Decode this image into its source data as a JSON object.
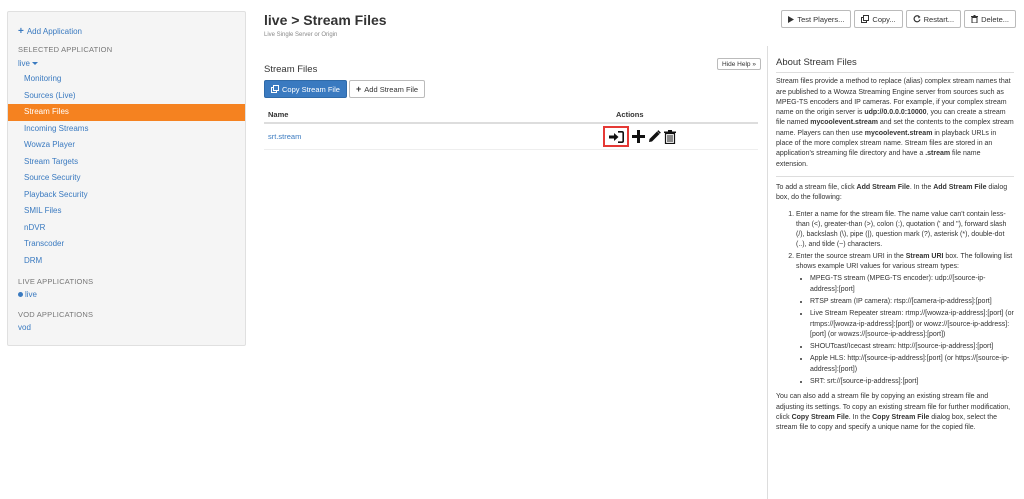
{
  "sidebar": {
    "add_application": "Add Application",
    "selected_heading": "SELECTED APPLICATION",
    "selected_app": "live",
    "nav": [
      {
        "label": "Monitoring",
        "active": false
      },
      {
        "label": "Sources (Live)",
        "active": false
      },
      {
        "label": "Stream Files",
        "active": true
      },
      {
        "label": "Incoming Streams",
        "active": false
      },
      {
        "label": "Wowza Player",
        "active": false
      },
      {
        "label": "Stream Targets",
        "active": false
      },
      {
        "label": "Source Security",
        "active": false
      },
      {
        "label": "Playback Security",
        "active": false
      },
      {
        "label": "SMIL Files",
        "active": false
      },
      {
        "label": "nDVR",
        "active": false
      },
      {
        "label": "Transcoder",
        "active": false
      },
      {
        "label": "DRM",
        "active": false
      }
    ],
    "live_heading": "LIVE APPLICATIONS",
    "live_app": "live",
    "vod_heading": "VOD APPLICATIONS",
    "vod_app": "vod"
  },
  "header": {
    "title": "live > Stream Files",
    "subtitle": "Live Single Server or Origin",
    "buttons": {
      "test_players": "Test Players...",
      "copy": "Copy...",
      "restart": "Restart...",
      "delete": "Delete..."
    }
  },
  "main": {
    "hide_help": "Hide Help »",
    "section_title": "Stream Files",
    "copy_button": "Copy Stream File",
    "add_button": "Add Stream File",
    "table": {
      "col_name": "Name",
      "col_actions": "Actions",
      "rows": [
        {
          "name": "srt.stream"
        }
      ]
    }
  },
  "help": {
    "title": "About Stream Files",
    "p1_a": "Stream files provide a method to replace (alias) complex stream names that are published to a Wowza Streaming Engine server from sources such as MPEG-TS encoders and IP cameras. For example, if your complex stream name on the origin server is ",
    "p1_b": "udp://0.0.0.0:10000",
    "p1_c": ", you can create a stream file named ",
    "p1_d": "mycoolevent.stream",
    "p1_e": " and set the contents to the complex stream name. Players can then use ",
    "p1_f": "mycoolevent.stream",
    "p1_g": " in playback URLs in place of the more complex stream name. Stream files are stored in an application's streaming file directory and have a ",
    "p1_h": ".stream",
    "p1_i": " file name extension.",
    "p2_a": "To add a stream file, click ",
    "p2_b": "Add Stream File",
    "p2_c": ". In the ",
    "p2_d": "Add Stream File",
    "p2_e": " dialog box, do the following:",
    "step1": "Enter a name for the stream file. The name value can't contain less-than (<), greater-than (>), colon (:), quotation (' and \"), forward slash (/), backslash (\\), pipe (|), question mark (?), asterisk (*), double-dot (..), and tilde (~) characters.",
    "step2_a": "Enter the source stream URI in the ",
    "step2_b": "Stream URI",
    "step2_c": " box. The following list shows example URI values for various stream types:",
    "uri_examples": [
      "MPEG-TS stream (MPEG-TS encoder): udp://[source-ip-address]:[port]",
      "RTSP stream (IP camera): rtsp://[camera-ip-address]:[port]",
      "Live Stream Repeater stream: rtmp://[wowza-ip-address]:[port] (or rtmps://[wowza-ip-address]:[port]) or wowz://[source-ip-address]:[port] (or wowzs://[source-ip-address]:[port])",
      "SHOUTcast/Icecast stream: http://[source-ip-address]:[port]",
      "Apple HLS: http://[source-ip-address]:[port] (or https://[source-ip-address]:[port])",
      "SRT: srt://[source-ip-address]:[port]"
    ],
    "p3_a": "You can also add a stream file by copying an existing stream file and adjusting its settings. To copy an existing stream file for further modification, click ",
    "p3_b": "Copy Stream File",
    "p3_c": ". In the ",
    "p3_d": "Copy Stream File",
    "p3_e": " dialog box, select the stream file to copy and specify a unique name for the copied file."
  },
  "colors": {
    "accent": "#3a7ac0",
    "active_nav": "#f58220",
    "highlight": "#e53935"
  }
}
